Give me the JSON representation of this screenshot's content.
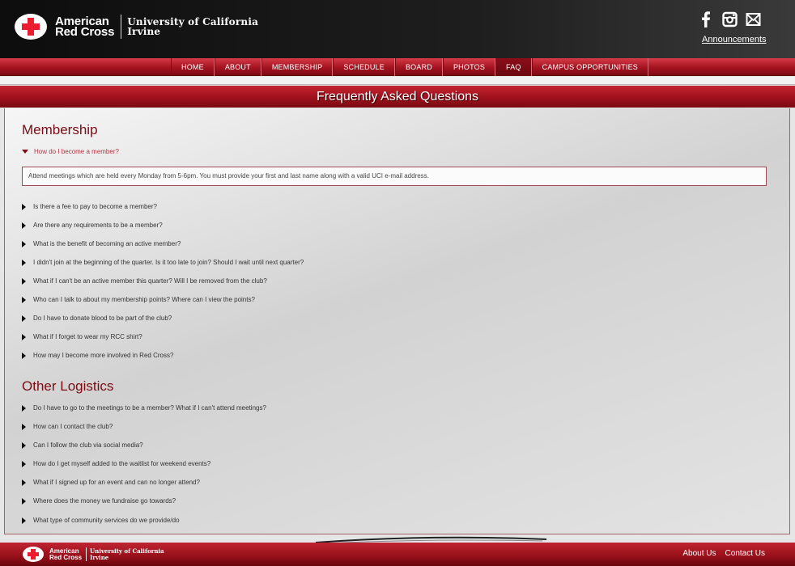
{
  "header": {
    "arc_line1": "American",
    "arc_line2": "Red Cross",
    "uci_line1": "University of California",
    "uci_line2": "Irvine",
    "announcements": "Announcements",
    "social_icons": [
      "facebook-icon",
      "instagram-icon",
      "mail-icon"
    ]
  },
  "nav": {
    "items": [
      "HOME",
      "ABOUT",
      "MEMBERSHIP",
      "SCHEDULE",
      "BOARD",
      "PHOTOS",
      "FAQ",
      "CAMPUS OPPORTUNITIES"
    ],
    "active": "FAQ"
  },
  "page": {
    "title": "Frequently Asked Questions"
  },
  "membership": {
    "title": "Membership",
    "open_question": "How do I become a member?",
    "open_answer": "Attend meetings which are held every Monday from 5-6pm. You must provide your first and last name along with a valid UCI e-mail address.",
    "questions": [
      "Is there a fee to pay to become a member?",
      "Are there any requirements to be a member?",
      "What is the benefit of becoming an active member?",
      "I didn't join at the beginning of the quarter. Is it too late to join? Should I wait until next quarter?",
      "What if I can't be an active member this quarter? Will I be removed from the club?",
      "Who can I talk to about my membership points? Where can I view the points?",
      "Do I have to donate blood to be part of the club?",
      "What if I forget to wear my RCC shirt?",
      "How may I become more involved in Red Cross?"
    ]
  },
  "logistics": {
    "title": "Other Logistics",
    "questions": [
      "Do I have to go to the meetings to be a member? What if I can't attend meetings?",
      "How can I contact the club?",
      "Can I follow the club via social media?",
      "How do I get myself added to the waitlist for weekend events?",
      "What if I signed up for an event and can no longer attend?",
      "Where does the money we fundraise go towards?",
      "What type of community services do we provide/do"
    ]
  },
  "footer": {
    "arc_line1": "American",
    "arc_line2": "Red Cross",
    "uci_line1": "University of California",
    "uci_line2": "Irvine",
    "links": [
      "About Us",
      "Contact Us"
    ]
  },
  "colors": {
    "brand_red": "#ed1b2e",
    "dark_red": "#7d0b13",
    "header_bg": "#1a1a1a"
  }
}
